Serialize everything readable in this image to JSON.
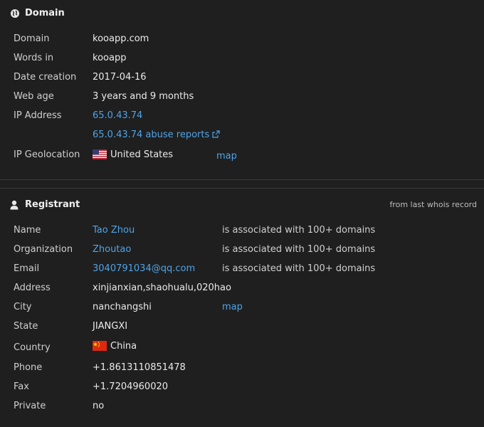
{
  "domain_section": {
    "title": "Domain",
    "rows": {
      "domain": {
        "label": "Domain",
        "value": "kooapp.com"
      },
      "words": {
        "label": "Words in",
        "value": "kooapp"
      },
      "created": {
        "label": "Date creation",
        "value": "2017-04-16"
      },
      "age": {
        "label": "Web age",
        "value": "3 years and 9 months"
      },
      "ip": {
        "label": "IP Address",
        "value": "65.0.43.74",
        "abuse_link": "65.0.43.74 abuse reports"
      },
      "geo": {
        "label": "IP Geolocation",
        "value": "United States",
        "map_link": "map"
      }
    }
  },
  "registrant_section": {
    "title": "Registrant",
    "note": "from last whois record",
    "rows": {
      "name": {
        "label": "Name",
        "value": "Tao Zhou",
        "assoc": "is associated with 100+ domains"
      },
      "org": {
        "label": "Organization",
        "value": "Zhoutao",
        "assoc": "is associated with 100+ domains"
      },
      "email": {
        "label": "Email",
        "value": "3040791034@qq.com",
        "assoc": "is associated with 100+ domains"
      },
      "address": {
        "label": "Address",
        "value": "xinjianxian,shaohualu,020hao"
      },
      "city": {
        "label": "City",
        "value": "nanchangshi",
        "map_link": "map"
      },
      "state": {
        "label": "State",
        "value": "JIANGXI"
      },
      "country": {
        "label": "Country",
        "value": "China"
      },
      "phone": {
        "label": "Phone",
        "value": "+1.8613110851478"
      },
      "fax": {
        "label": "Fax",
        "value": "+1.7204960020"
      },
      "private": {
        "label": "Private",
        "value": "no"
      }
    }
  },
  "colors": {
    "background": "#1f1f1f",
    "link": "#4fa3e8",
    "divider": "#3a3a3a"
  }
}
